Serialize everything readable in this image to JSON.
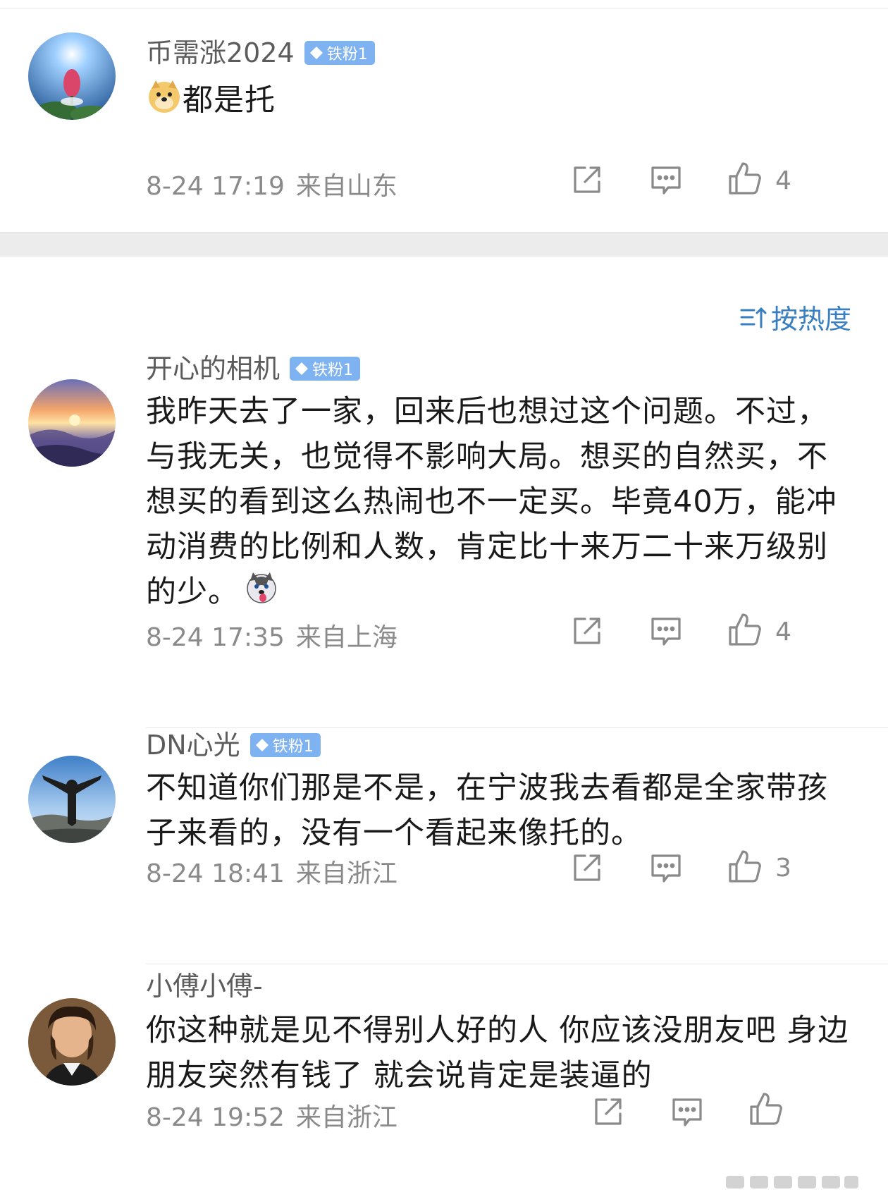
{
  "comments": [
    {
      "username": "币需涨2024",
      "badge": "铁粉1",
      "text": "都是托",
      "time": "8-24 17:19",
      "location": "来自山东",
      "likes": "4"
    },
    {
      "username": "开心的相机",
      "badge": "铁粉1",
      "text": "我昨天去了一家，回来后也想过这个问题。不过，与我无关，也觉得不影响大局。想买的自然买，不想买的看到这么热闹也不一定买。毕竟40万，能冲动消费的比例和人数，肯定比十来万二十来万级别的少。",
      "time": "8-24 17:35",
      "location": "来自上海",
      "likes": "4"
    },
    {
      "username": "DN心光",
      "badge": "铁粉1",
      "text": "不知道你们那是不是，在宁波我去看都是全家带孩子来看的，没有一个看起来像托的。",
      "time": "8-24 18:41",
      "location": "来自浙江",
      "likes": "3"
    },
    {
      "username": "小傅小傅-",
      "text": "你这种就是见不得别人好的人 你应该没朋友吧 身边朋友突然有钱了 就会说肯定是装逼的",
      "time": "8-24 19:52",
      "location": "来自浙江"
    }
  ],
  "sort_label": "按热度",
  "colors": {
    "accent": "#3a7fc2",
    "badge": "#7fb2f0",
    "meta": "#8a8a8a"
  },
  "icons": [
    "share-icon",
    "comment-icon",
    "like-icon",
    "sort-icon",
    "diamond-icon",
    "doge-emoji",
    "husky-emoji"
  ]
}
